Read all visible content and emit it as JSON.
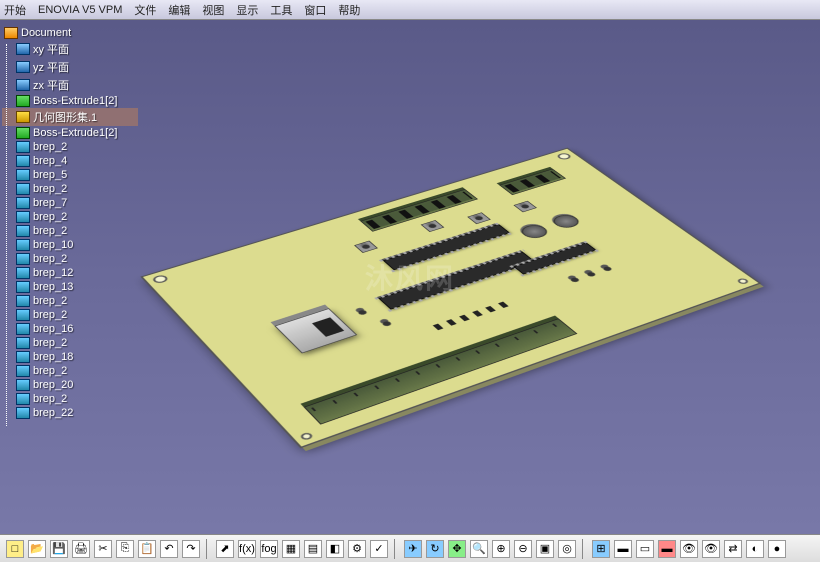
{
  "menubar": [
    "开始",
    "ENOVIA V5 VPM",
    "文件",
    "编辑",
    "视图",
    "显示",
    "工具",
    "窗口",
    "帮助"
  ],
  "tree": {
    "root": "Document",
    "items": [
      {
        "label": "xy 平面",
        "type": "plane"
      },
      {
        "label": "yz 平面",
        "type": "plane"
      },
      {
        "label": "zx 平面",
        "type": "plane"
      },
      {
        "label": "Boss-Extrude1[2]",
        "type": "feat"
      },
      {
        "label": "几何图形集.1",
        "type": "geom",
        "active": true
      },
      {
        "label": "Boss-Extrude1[2]",
        "type": "feat"
      },
      {
        "label": "brep_2",
        "type": "part"
      },
      {
        "label": "brep_4",
        "type": "part"
      },
      {
        "label": "brep_5",
        "type": "part"
      },
      {
        "label": "brep_2",
        "type": "part"
      },
      {
        "label": "brep_7",
        "type": "part"
      },
      {
        "label": "brep_2",
        "type": "part"
      },
      {
        "label": "brep_2",
        "type": "part"
      },
      {
        "label": "brep_10",
        "type": "part"
      },
      {
        "label": "brep_2",
        "type": "part"
      },
      {
        "label": "brep_12",
        "type": "part"
      },
      {
        "label": "brep_13",
        "type": "part"
      },
      {
        "label": "brep_2",
        "type": "part"
      },
      {
        "label": "brep_2",
        "type": "part"
      },
      {
        "label": "brep_16",
        "type": "part"
      },
      {
        "label": "brep_2",
        "type": "part"
      },
      {
        "label": "brep_18",
        "type": "part"
      },
      {
        "label": "brep_2",
        "type": "part"
      },
      {
        "label": "brep_20",
        "type": "part"
      },
      {
        "label": "brep_2",
        "type": "part"
      },
      {
        "label": "brep_22",
        "type": "part"
      }
    ]
  },
  "watermark": "沐风网",
  "toolbar_icons": [
    {
      "name": "new",
      "glyph": "□",
      "cls": "yel"
    },
    {
      "name": "open",
      "glyph": "📂",
      "cls": ""
    },
    {
      "name": "save",
      "glyph": "💾",
      "cls": ""
    },
    {
      "name": "print",
      "glyph": "🖨",
      "cls": ""
    },
    {
      "name": "cut",
      "glyph": "✂",
      "cls": ""
    },
    {
      "name": "copy",
      "glyph": "⎘",
      "cls": ""
    },
    {
      "name": "paste",
      "glyph": "📋",
      "cls": ""
    },
    {
      "name": "undo",
      "glyph": "↶",
      "cls": ""
    },
    {
      "name": "redo",
      "glyph": "↷",
      "cls": ""
    },
    {
      "name": "sep",
      "glyph": "",
      "cls": "sep"
    },
    {
      "name": "pointer",
      "glyph": "⬈",
      "cls": ""
    },
    {
      "name": "fx",
      "glyph": "f(x)",
      "cls": ""
    },
    {
      "name": "rule",
      "glyph": "fog",
      "cls": ""
    },
    {
      "name": "design-table",
      "glyph": "▦",
      "cls": ""
    },
    {
      "name": "law",
      "glyph": "▤",
      "cls": ""
    },
    {
      "name": "knowledge",
      "glyph": "◧",
      "cls": ""
    },
    {
      "name": "relations",
      "glyph": "⚙",
      "cls": ""
    },
    {
      "name": "check",
      "glyph": "✓",
      "cls": ""
    },
    {
      "name": "sep2",
      "glyph": "",
      "cls": "sep"
    },
    {
      "name": "fly",
      "glyph": "✈",
      "cls": "blu"
    },
    {
      "name": "rotate",
      "glyph": "↻",
      "cls": "blu"
    },
    {
      "name": "pan",
      "glyph": "✥",
      "cls": "grn"
    },
    {
      "name": "zoom",
      "glyph": "🔍",
      "cls": ""
    },
    {
      "name": "zoom-in",
      "glyph": "⊕",
      "cls": ""
    },
    {
      "name": "zoom-out",
      "glyph": "⊖",
      "cls": ""
    },
    {
      "name": "fit",
      "glyph": "▣",
      "cls": ""
    },
    {
      "name": "normal-view",
      "glyph": "◎",
      "cls": ""
    },
    {
      "name": "sep3",
      "glyph": "",
      "cls": "sep"
    },
    {
      "name": "views",
      "glyph": "⊞",
      "cls": "blu"
    },
    {
      "name": "render1",
      "glyph": "▬",
      "cls": ""
    },
    {
      "name": "render2",
      "glyph": "▭",
      "cls": ""
    },
    {
      "name": "render3",
      "glyph": "▬",
      "cls": "red"
    },
    {
      "name": "hide",
      "glyph": "👁",
      "cls": ""
    },
    {
      "name": "show",
      "glyph": "👁",
      "cls": ""
    },
    {
      "name": "swap",
      "glyph": "⇄",
      "cls": ""
    },
    {
      "name": "shading",
      "glyph": "◐",
      "cls": ""
    },
    {
      "name": "material",
      "glyph": "●",
      "cls": ""
    }
  ]
}
